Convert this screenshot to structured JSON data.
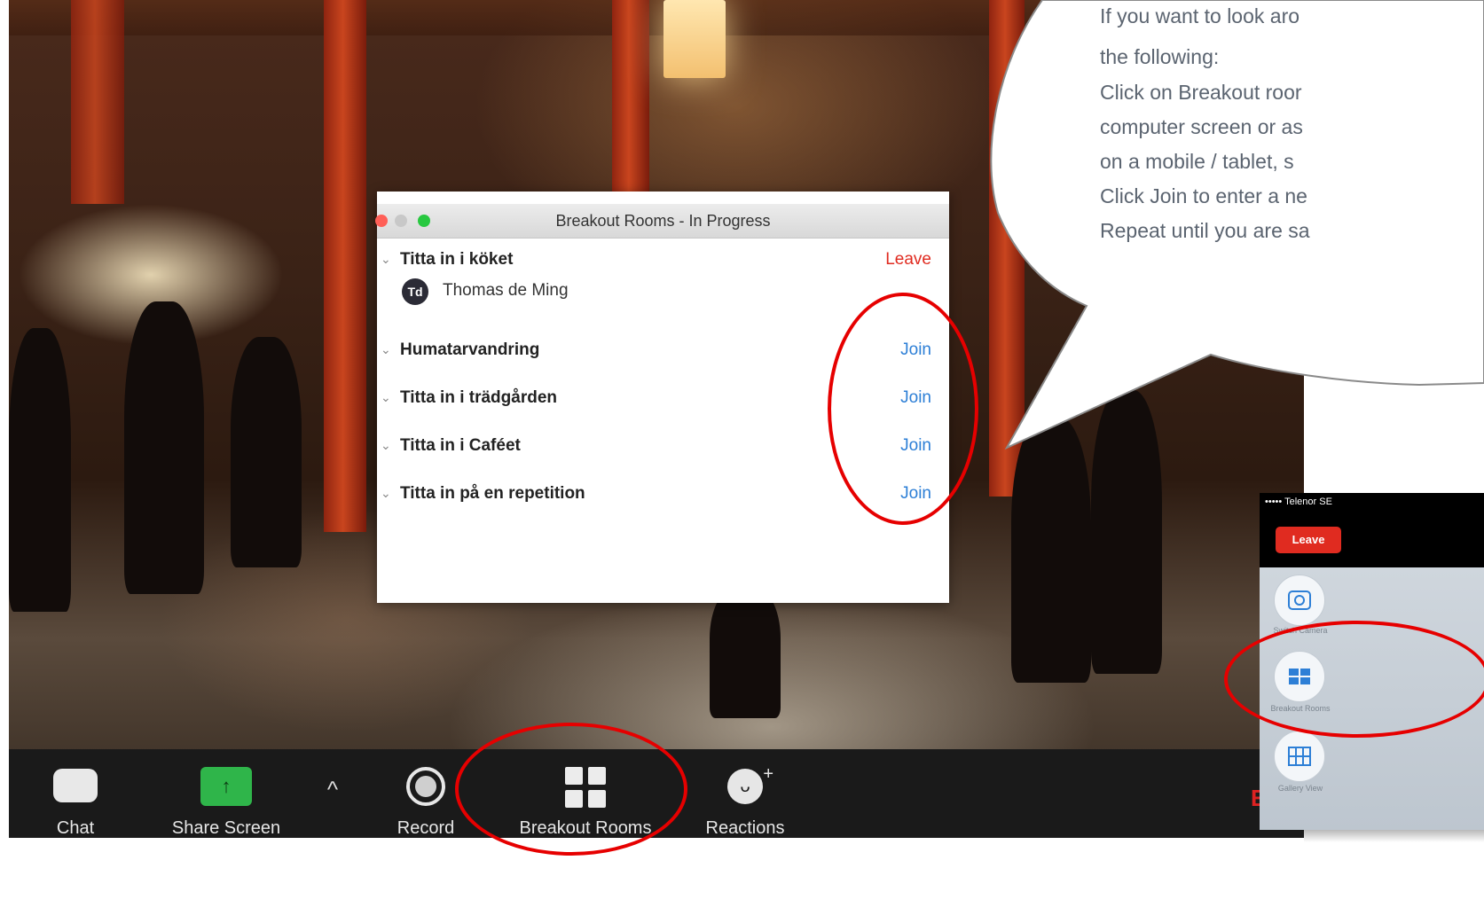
{
  "dialog": {
    "title": "Breakout Rooms - In Progress",
    "rooms": [
      {
        "name": "Titta in i köket",
        "action": "Leave"
      },
      {
        "name": "Humatarvandring",
        "action": "Join"
      },
      {
        "name": "Titta in i trädgården",
        "action": "Join"
      },
      {
        "name": "Titta in i Caféet",
        "action": "Join"
      },
      {
        "name": "Titta in på en repetition",
        "action": "Join"
      }
    ],
    "participant": {
      "initials": "Td",
      "name": "Thomas de Ming"
    }
  },
  "toolbar": {
    "chat": "Chat",
    "share_screen": "Share Screen",
    "record": "Record",
    "breakout_rooms": "Breakout Rooms",
    "reactions": "Reactions",
    "share_icon": "↑",
    "caret_icon": "^",
    "edge_text": "E"
  },
  "bubble": {
    "lines": [
      "If you want to look aro",
      "the following:",
      "Click on Breakout roor",
      "computer screen or as",
      "on a mobile / tablet, s",
      "Click Join to enter a ne",
      "Repeat until you are sa"
    ]
  },
  "phone": {
    "status": "••••• Telenor SE",
    "leave": "Leave",
    "labels": [
      "Switch Camera",
      "Breakout Rooms",
      "Gallery View"
    ]
  },
  "colors": {
    "annotation": "#e60000",
    "join": "#2d7fd6",
    "leave": "#e02b20",
    "share_green": "#2fb54a"
  }
}
